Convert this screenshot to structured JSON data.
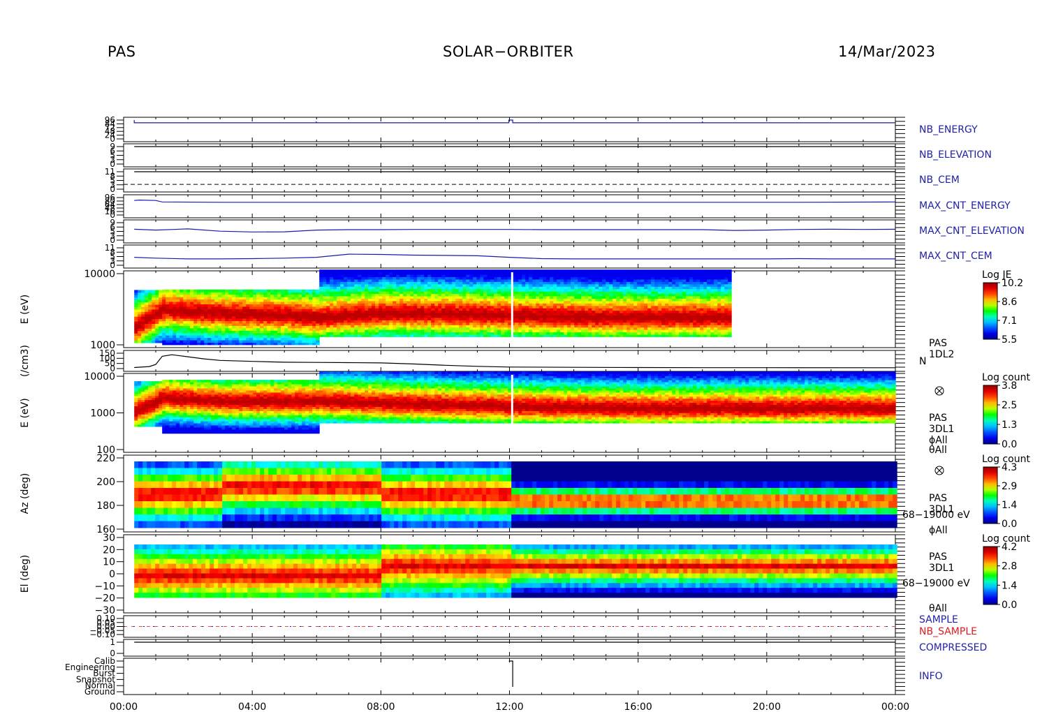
{
  "header": {
    "left": "PAS",
    "center": "SOLAR−ORBITER",
    "right": "14/Mar/2023"
  },
  "chart_data": {
    "type": "heatmap",
    "time_axis": {
      "ticks": [
        "00:00",
        "04:00",
        "08:00",
        "12:00",
        "16:00",
        "20:00",
        "00:00"
      ],
      "range_hours": [
        0,
        24
      ]
    },
    "panels": [
      {
        "id": "nb-energy",
        "type": "line",
        "label": "NB_ENERGY",
        "label_color": "#1f1fa8",
        "tick_labels": [
          "96",
          "84",
          "72",
          "48",
          "24",
          "0"
        ],
        "series": [
          {
            "color": "#1a1aa8",
            "x": [
              0.33,
              0.33,
              5.99,
              5.99,
              6.02,
              11.98,
              11.98,
              12.1,
              12.1,
              18.0,
              18.0,
              18.02,
              24
            ],
            "y": [
              96,
              82,
              82,
              86,
              82,
              82,
              96,
              96,
              82,
              82,
              86,
              82,
              82
            ]
          }
        ]
      },
      {
        "id": "nb-elevation",
        "type": "line",
        "label": "NB_ELEVATION",
        "label_color": "#1f1fa8",
        "tick_labels": [
          "9",
          "6",
          "5",
          "3",
          "0"
        ],
        "series": [
          {
            "color": "#000000",
            "x": [
              0.33,
              24
            ],
            "y": [
              9,
              9
            ]
          }
        ]
      },
      {
        "id": "nb-cem",
        "type": "line",
        "label": "NB_CEM",
        "label_color": "#1f1fa8",
        "tick_labels": [
          "11",
          "8",
          "5",
          "3",
          "0"
        ],
        "series": [
          {
            "color": "#000000",
            "x": [
              0.33,
              24
            ],
            "y": [
              11,
              11
            ]
          }
        ],
        "dashed_level": 3
      },
      {
        "id": "max-cnt-energy",
        "type": "line",
        "label": "MAX_CNT_ENERGY",
        "label_color": "#1f1fa8",
        "tick_labels": [
          "96",
          "80",
          "64",
          "48",
          "16",
          "0"
        ],
        "series": [
          {
            "color": "#1a1aa8",
            "x": [
              0.33,
              0.5,
              1.0,
              1.2,
              3,
              6,
              9,
              12,
              15,
              18,
              21,
              24
            ],
            "y": [
              80,
              82,
              80,
              72,
              70,
              70,
              70,
              70,
              70,
              70,
              70,
              72
            ]
          }
        ]
      },
      {
        "id": "max-cnt-elevation",
        "type": "line",
        "label": "MAX_CNT_ELEVATION",
        "label_color": "#1f1fa8",
        "tick_labels": [
          "9",
          "6",
          "5",
          "3",
          "0"
        ],
        "series": [
          {
            "color": "#1a1aa8",
            "x": [
              0.33,
              1,
              2,
              3,
              4,
              5,
              6,
              7,
              8,
              9,
              10,
              11,
              12,
              13,
              14,
              15,
              16,
              17,
              18,
              19,
              20,
              21,
              22,
              23,
              24
            ],
            "y": [
              5.6,
              5.2,
              5.8,
              4.6,
              4.2,
              4.3,
              5.2,
              5.4,
              5.4,
              5.5,
              5.5,
              5.5,
              5.5,
              5.4,
              5.4,
              5.4,
              5.4,
              5.4,
              5.4,
              5.0,
              5.2,
              5.5,
              5.6,
              5.5,
              5.6
            ]
          }
        ]
      },
      {
        "id": "max-cnt-cem",
        "type": "line",
        "label": "MAX_CNT_CEM",
        "label_color": "#1f1fa8",
        "tick_labels": [
          "11",
          "8",
          "5",
          "3",
          "0"
        ],
        "series": [
          {
            "color": "#1a1aa8",
            "x": [
              0.33,
              1,
              2,
              3,
              4,
              5,
              6,
              7,
              8,
              9,
              10,
              11,
              12,
              13,
              14,
              15,
              16,
              17,
              18,
              19,
              20,
              21,
              22,
              23,
              24
            ],
            "y": [
              5,
              4.5,
              4,
              4,
              4.2,
              4.5,
              5,
              7,
              6.8,
              6.4,
              6.2,
              6,
              5,
              4.2,
              4,
              4,
              4,
              4,
              4,
              4,
              4,
              4.2,
              4,
              4,
              4
            ]
          }
        ]
      },
      {
        "id": "energy-1d",
        "type": "heatmap",
        "ylabel": "E (eV)",
        "y_scale": "log",
        "tick_labels": [
          "10000",
          "1000"
        ],
        "yrange": [
          300,
          25000
        ],
        "colorbar": {
          "title": "Log JE",
          "ticks": [
            "10.2",
            "8.6",
            "7.1",
            "5.5"
          ]
        },
        "side_label": [
          "PAS",
          "1DL2"
        ],
        "time_range": [
          0.33,
          18.9
        ],
        "peak_log_energy": [
          2.95,
          3.4,
          3.3,
          3.25,
          3.2,
          3.3,
          3.3,
          3.25,
          3.2,
          3.2
        ],
        "peak_times": [
          0.33,
          1.2,
          3,
          5,
          6,
          8,
          9,
          12,
          15,
          18.9
        ]
      },
      {
        "id": "density",
        "type": "line",
        "ylabel": "(/cm3)",
        "side_label": "N",
        "tick_labels": [
          "150",
          "100",
          "50",
          "0"
        ],
        "series": [
          {
            "color": "#000000",
            "x": [
              0.33,
              0.8,
              1.0,
              1.2,
              1.5,
              2.0,
              2.5,
              3.0,
              4.0,
              5.0,
              6.0,
              7.0,
              8.0,
              9.0,
              10.0,
              11.0,
              12.0,
              14.0,
              16.0,
              18.0,
              20.0,
              24.0
            ],
            "y": [
              10,
              20,
              40,
              120,
              135,
              115,
              95,
              80,
              70,
              62,
              60,
              58,
              55,
              45,
              32,
              22,
              15,
              12,
              10,
              9,
              9,
              8
            ]
          }
        ]
      },
      {
        "id": "energy-3d",
        "type": "heatmap",
        "ylabel": "E (eV)",
        "y_scale": "log",
        "tick_labels": [
          "10000",
          "1000",
          "100"
        ],
        "yrange": [
          70,
          14000
        ],
        "colorbar": {
          "title": "Log count",
          "ticks": [
            "3.8",
            "2.5",
            "1.3",
            "0.0"
          ]
        },
        "side_label": [
          "PAS",
          "3DL1",
          "ϕAll",
          "θAll"
        ],
        "time_range": [
          0.33,
          24
        ],
        "peak_log_energy": [
          3.0,
          3.4,
          3.3,
          3.3,
          3.25,
          3.2,
          3.15,
          3.1,
          3.1,
          3.1
        ],
        "peak_times": [
          0.33,
          1.2,
          3,
          6,
          8,
          10,
          12,
          16,
          20,
          24
        ]
      },
      {
        "id": "azimuth",
        "type": "heatmap",
        "ylabel": "Az (deg)",
        "tick_labels": [
          "220",
          "200",
          "180",
          "160"
        ],
        "yrange": [
          152,
          228
        ],
        "colorbar": {
          "title": "Log count",
          "ticks": [
            "4.3",
            "2.9",
            "1.4",
            "0.0"
          ]
        },
        "side_label": [
          "PAS",
          "3DL1",
          "68−19000 eV",
          "ϕAll"
        ],
        "time_range": [
          0.33,
          24
        ]
      },
      {
        "id": "elevation",
        "type": "heatmap",
        "ylabel": "El (deg)",
        "tick_labels": [
          "30",
          "20",
          "10",
          "0",
          "−10",
          "−20",
          "−30"
        ],
        "yrange": [
          -30,
          30
        ],
        "colorbar": {
          "title": "Log count",
          "ticks": [
            "4.2",
            "2.8",
            "1.4",
            "0.0"
          ]
        },
        "side_label": [
          "PAS",
          "3DL1",
          "68−19000 eV",
          "θAll"
        ],
        "time_range": [
          0.33,
          24
        ]
      },
      {
        "id": "sample",
        "type": "line",
        "tick_labels": [
          "0.10",
          "0.05",
          "0.00",
          "−0.05",
          "−0.10"
        ],
        "labels": [
          {
            "text": "SAMPLE",
            "color": "#1f1fa8"
          },
          {
            "text": "NB_SAMPLE",
            "color": "#e01c1c"
          }
        ]
      },
      {
        "id": "compressed",
        "type": "line",
        "label": "COMPRESSED",
        "label_color": "#1f1fa8",
        "tick_labels": [
          "1",
          "0"
        ],
        "series": [
          {
            "color": "#000000",
            "x": [
              0.33,
              24
            ],
            "y": [
              1,
              1
            ]
          }
        ]
      },
      {
        "id": "info",
        "type": "line",
        "label": "INFO",
        "label_color": "#1f1fa8",
        "tick_labels": [
          "Calib",
          "Engineering",
          "Burst",
          "Snapshot",
          "Normal",
          "Ground"
        ],
        "series": [
          {
            "color": "#000000",
            "x": [
              11.98,
              12.0,
              12.0,
              12.1,
              12.1
            ],
            "y": [
              5,
              5,
              5,
              5,
              0.8
            ]
          }
        ]
      }
    ]
  }
}
